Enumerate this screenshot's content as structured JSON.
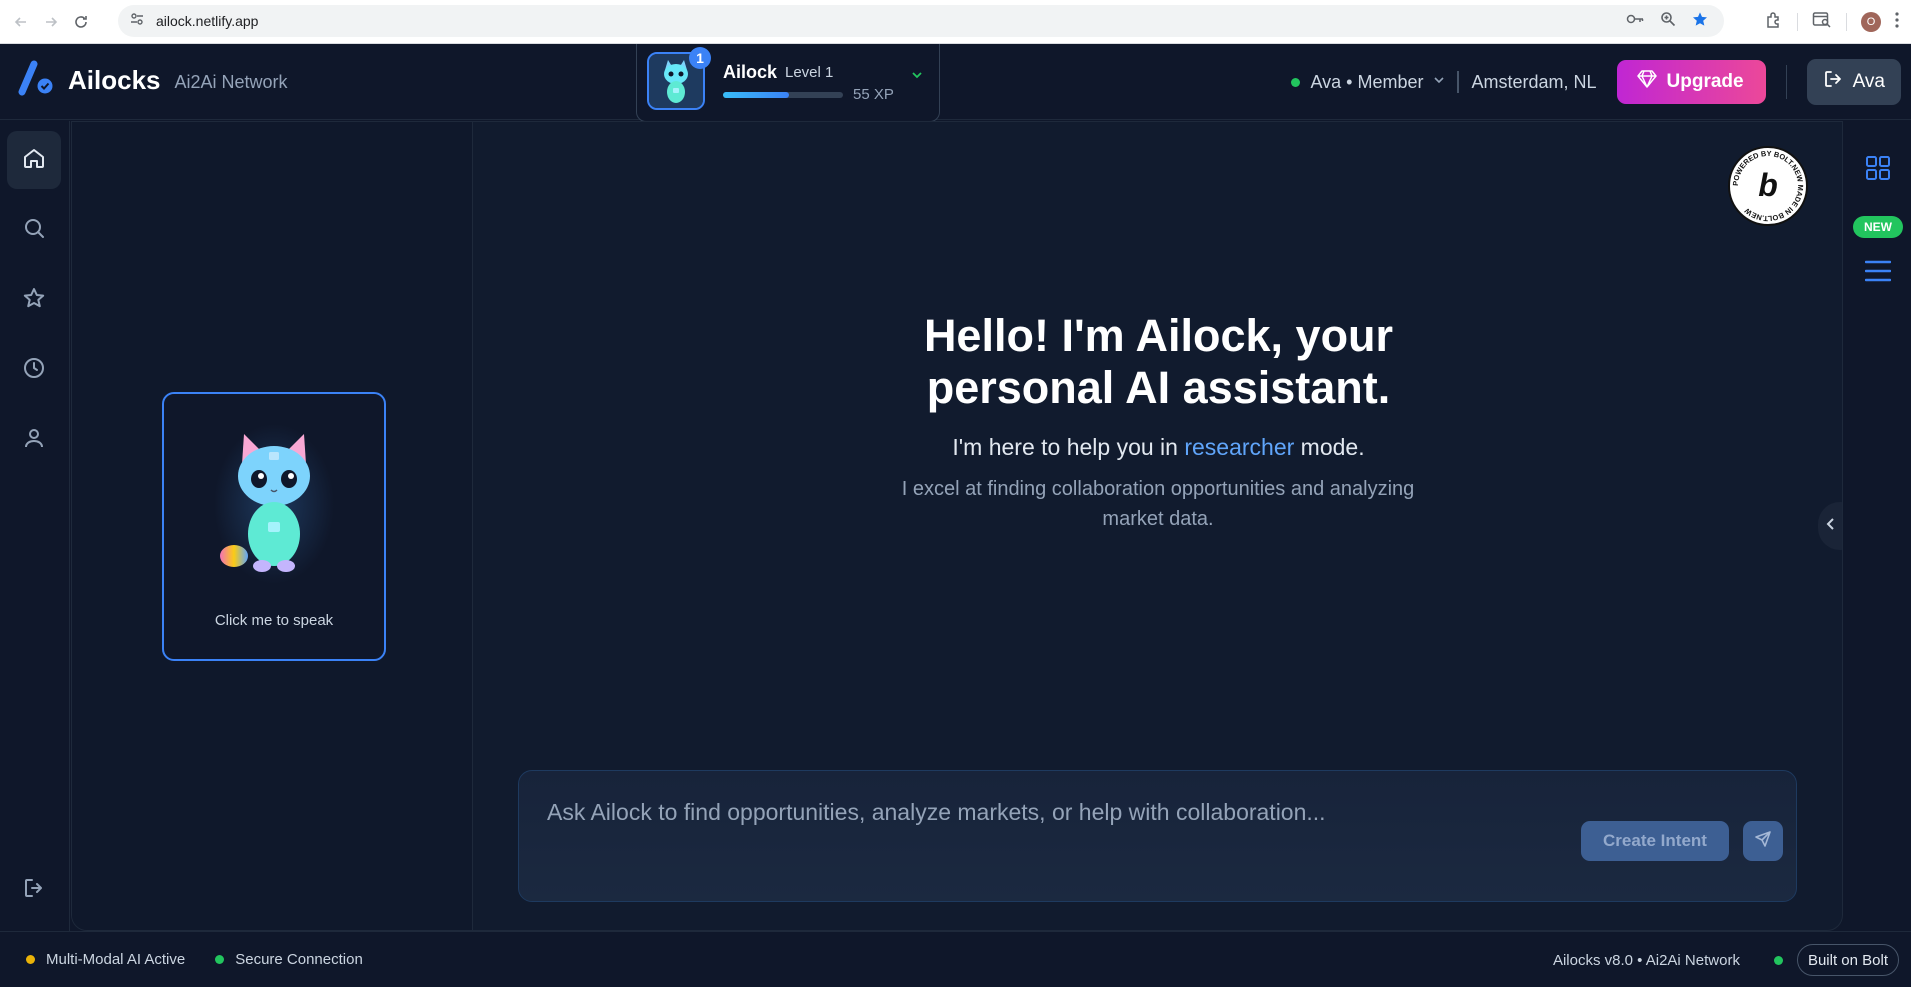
{
  "browser": {
    "url": "ailock.netlify.app",
    "profile_initial": "O"
  },
  "header": {
    "brand_title": "Ailocks",
    "brand_subtitle": "Ai2Ai Network",
    "ailock": {
      "name": "Ailock",
      "level_label": "Level 1",
      "level_badge": "1",
      "xp_text": "55 XP",
      "xp_progress_fraction": 0.55
    },
    "user": {
      "status": "online",
      "label": "Ava • Member",
      "location": "Amsterdam, NL"
    },
    "upgrade_label": "Upgrade",
    "account_label": "Ava"
  },
  "left_nav": {
    "items": [
      {
        "name": "home",
        "icon": "home-icon",
        "active": true
      },
      {
        "name": "search",
        "icon": "search-icon",
        "active": false
      },
      {
        "name": "favorites",
        "icon": "star-icon",
        "active": false
      },
      {
        "name": "history",
        "icon": "clock-icon",
        "active": false
      },
      {
        "name": "profile",
        "icon": "user-icon",
        "active": false
      }
    ],
    "logout_icon": "logout-icon"
  },
  "cat_card": {
    "caption": "Click me to speak"
  },
  "main": {
    "greeting_line1": "Hello! I'm Ailock, your",
    "greeting_line2": "personal AI assistant.",
    "mode_prefix": "I'm here to help you in ",
    "mode_word": "researcher",
    "mode_suffix": " mode.",
    "description": "I excel at finding collaboration opportunities and analyzing market data."
  },
  "composer": {
    "placeholder": "Ask Ailock to find opportunities, analyze markets, or help with collaboration...",
    "value": "",
    "create_intent_label": "Create Intent"
  },
  "right_rail": {
    "new_badge": "NEW"
  },
  "footer": {
    "multimodal_label": "Multi-Modal AI Active",
    "secure_label": "Secure Connection",
    "version_label": "Ailocks v8.0 • Ai2Ai Network",
    "built_label": "Built on Bolt"
  },
  "colors": {
    "background": "#0f172a",
    "accent": "#3b82f6",
    "upgrade_gradient_start": "#c026d3",
    "upgrade_gradient_end": "#ec4899",
    "online": "#22c55e",
    "warning": "#eab308"
  }
}
